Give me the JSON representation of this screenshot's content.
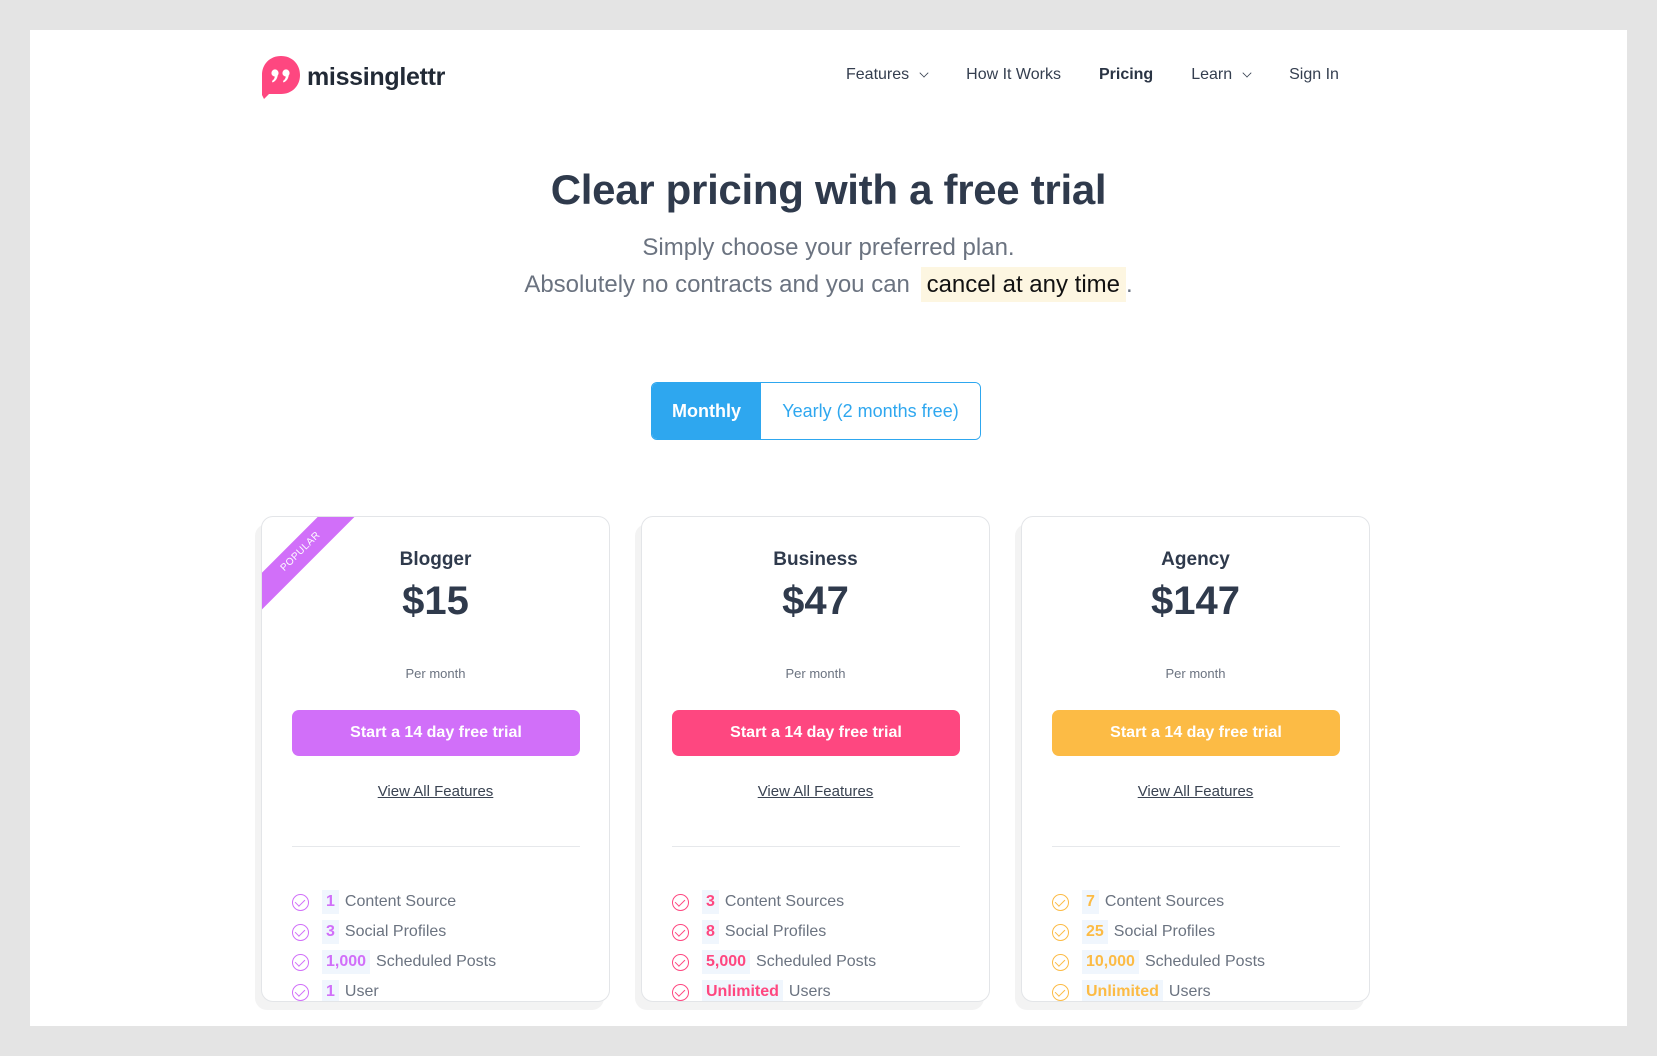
{
  "brand": {
    "name": "missinglettr",
    "color": "#fe4780"
  },
  "nav": {
    "items": [
      {
        "label": "Features",
        "has_dropdown": true,
        "active": false
      },
      {
        "label": "How It Works",
        "has_dropdown": false,
        "active": false
      },
      {
        "label": "Pricing",
        "has_dropdown": false,
        "active": true
      },
      {
        "label": "Learn",
        "has_dropdown": true,
        "active": false
      },
      {
        "label": "Sign In",
        "has_dropdown": false,
        "active": false
      }
    ]
  },
  "hero": {
    "title": "Clear pricing with a free trial",
    "subtitle_line1": "Simply choose your preferred plan.",
    "subtitle_line2_prefix": "Absolutely no contracts and you can",
    "subtitle_line2_highlight": "cancel at any time",
    "subtitle_line2_suffix": "."
  },
  "billing_toggle": {
    "options": [
      "Monthly",
      "Yearly (2 months free)"
    ],
    "selected": "Monthly",
    "accent": "#2ea7ef"
  },
  "plans": [
    {
      "name": "Blogger",
      "price": "$15",
      "period": "Per month",
      "badge": "POPULAR",
      "cta": "Start a 14 day free trial",
      "link": "View All Features",
      "color": "#d16ff9",
      "features": [
        {
          "value": "1",
          "label": "Content Source"
        },
        {
          "value": "3",
          "label": "Social Profiles"
        },
        {
          "value": "1,000",
          "label": "Scheduled Posts"
        },
        {
          "value": "1",
          "label": "User"
        }
      ]
    },
    {
      "name": "Business",
      "price": "$47",
      "period": "Per month",
      "cta": "Start a 14 day free trial",
      "link": "View All Features",
      "color": "#fe4780",
      "features": [
        {
          "value": "3",
          "label": "Content Sources"
        },
        {
          "value": "8",
          "label": "Social Profiles"
        },
        {
          "value": "5,000",
          "label": "Scheduled Posts"
        },
        {
          "value": "Unlimited",
          "label": "Users"
        }
      ]
    },
    {
      "name": "Agency",
      "price": "$147",
      "period": "Per month",
      "cta": "Start a 14 day free trial",
      "link": "View All Features",
      "color": "#fcbb45",
      "features": [
        {
          "value": "7",
          "label": "Content Sources"
        },
        {
          "value": "25",
          "label": "Social Profiles"
        },
        {
          "value": "10,000",
          "label": "Scheduled Posts"
        },
        {
          "value": "Unlimited",
          "label": "Users"
        }
      ]
    }
  ]
}
